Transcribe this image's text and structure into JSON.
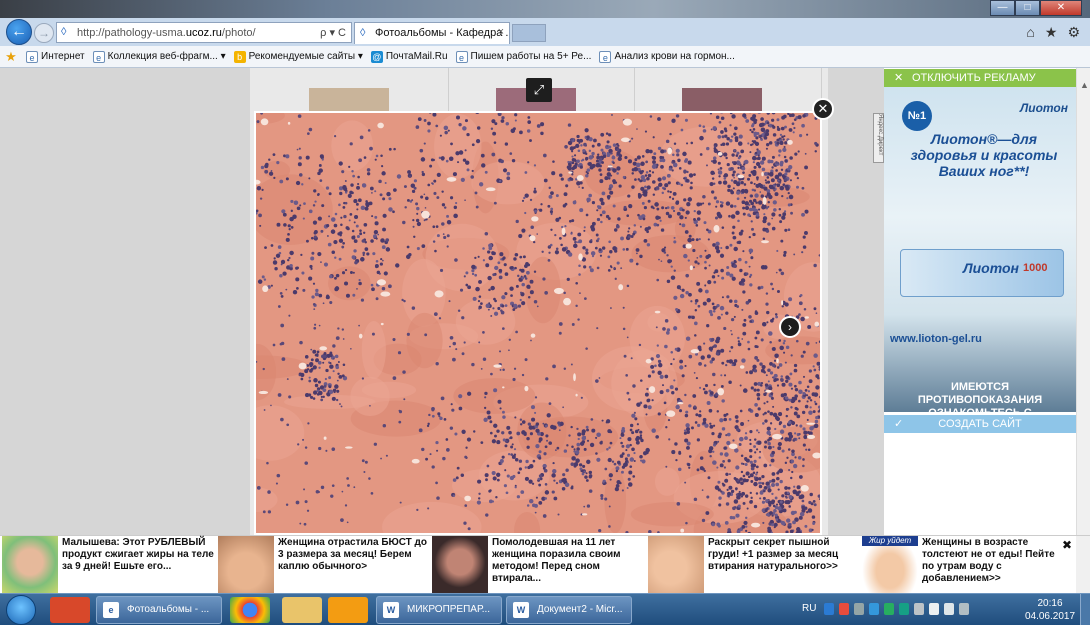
{
  "browser": {
    "address_url_prefix": "http://pathology-usma.",
    "address_url_domain": "ucoz.ru",
    "address_url_suffix": "/photo/",
    "address_tools": "ρ ▾ C",
    "tab_title": "Фотоальбомы - Кафедра ...",
    "tab_close": "×",
    "back_glyph": "←",
    "forward_glyph": "→",
    "window_buttons": [
      "—",
      "□",
      "✕"
    ],
    "top_icons": [
      "⌂",
      "★",
      "⚙"
    ]
  },
  "favorites": [
    {
      "label": "Интернет",
      "icon": "page-icon"
    },
    {
      "label": "Коллекция веб-фрагм... ▾",
      "icon": "page-icon"
    },
    {
      "label": "Рекомендуемые сайты ▾",
      "icon": "bing-icon"
    },
    {
      "label": "ПочтаMail.Ru",
      "icon": "mail-icon"
    },
    {
      "label": "Пишем работы на 5+  Ре...",
      "icon": "page-icon"
    },
    {
      "label": "Анализ крови на гормон...",
      "icon": "page-icon"
    }
  ],
  "viewer": {
    "expand_glyph": "⤢",
    "close_glyph": "✕",
    "next_glyph": "›"
  },
  "ad": {
    "disable_label": "ОТКЛЮЧИТЬ РЕКЛАМУ",
    "disable_x": "✕",
    "brand": "Лиотон",
    "badge": "№1",
    "headline": "Лиотон®—для здоровья и красоты Ваших ног**!",
    "product_name": "Лиотон",
    "product_dose": "1000",
    "site": "www.lioton-gel.ru",
    "warning": "ИМЕЮТСЯ ПРОТИВОПОКАЗАНИЯ ОЗНАКОМЬТЕСЬ С ИНСТРУКЦИЕЙ ПО ПРИМЕНЕНИЮ",
    "side_tag": "Яндекс.Директ",
    "create_label": "СОЗДАТЬ САЙТ",
    "create_check": "✓"
  },
  "teasers": [
    {
      "text": "Малышева: Этот РУБЛЕВЫЙ продукт сжигает жиры на теле за 9 дней! Ешьте его..."
    },
    {
      "text": "Женщина отрастила БЮСТ до 3 размера за месяц! Берем каплю обычного>"
    },
    {
      "text": "Помолодевшая на 11 лет женщина поразила своим методом! Перед сном втирала..."
    },
    {
      "text": "Раскрыт секрет пышной груди! +1 размер за месяц втирания натурального>>"
    },
    {
      "text": "Женщины в возрасте толстеют не от еды! Пейте по утрам воду с добавлением>>"
    }
  ],
  "teaser_badge": "Жир уйдет",
  "teaser_close": "✖",
  "taskbar": {
    "buttons": [
      {
        "label": "Фотоальбомы - ...",
        "icon": "e"
      },
      {
        "label": "МИКРОПРЕПАР...",
        "icon": "W"
      },
      {
        "label": "Документ2 - Micr...",
        "icon": "W"
      }
    ],
    "lang": "RU",
    "time": "20:16",
    "date": "04.06.2017"
  }
}
